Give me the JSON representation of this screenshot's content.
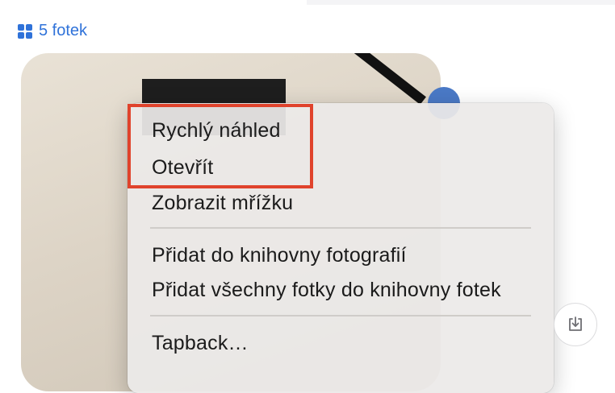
{
  "header": {
    "photo_count_label": "5 fotek",
    "icon": "grid-icon"
  },
  "context_menu": {
    "items": [
      {
        "label": "Rychlý náhled"
      },
      {
        "label": "Otevřít"
      },
      {
        "label": "Zobrazit mřížku"
      },
      {
        "label": "Přidat do knihovny fotografií"
      },
      {
        "label": "Přidat všechny fotky do knihovny fotek"
      },
      {
        "label": "Tapback…"
      }
    ]
  },
  "save_button": {
    "icon": "download-tray-icon"
  },
  "colors": {
    "accent": "#2f72d9",
    "highlight": "#e0432c",
    "menu_bg": "#eceae8"
  }
}
